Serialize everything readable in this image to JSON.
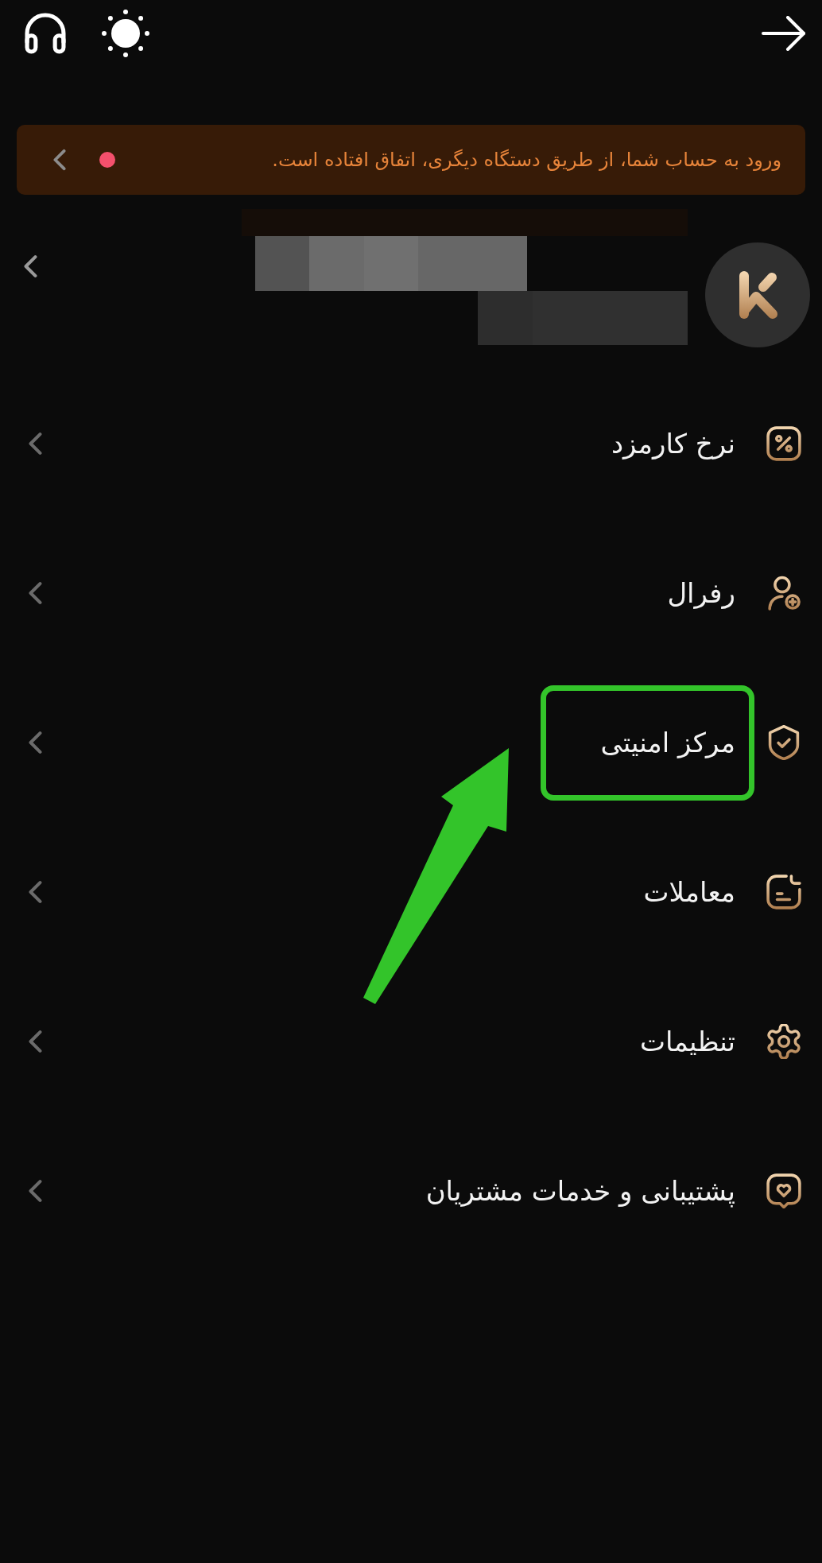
{
  "banner": {
    "message": "ورود به حساب شما، از طریق دستگاه دیگری، اتفاق افتاده است.",
    "unread": true
  },
  "menu": [
    {
      "label": "نرخ کارمزد",
      "highlighted": false
    },
    {
      "label": "رفرال",
      "highlighted": false
    },
    {
      "label": "مرکز امنیتی",
      "highlighted": true
    },
    {
      "label": "معاملات",
      "highlighted": false
    },
    {
      "label": "تنظیمات",
      "highlighted": false
    },
    {
      "label": "پشتیبانی و خدمات مشتریان",
      "highlighted": false
    }
  ]
}
